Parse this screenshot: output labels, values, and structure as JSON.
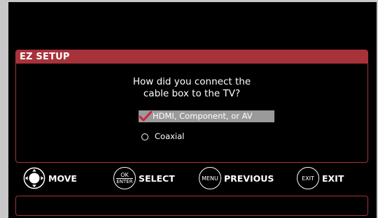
{
  "setup": {
    "title": "EZ SETUP",
    "question": "How did you connect the\ncable box to the TV?",
    "options": [
      {
        "label": "HDMI, Component, or AV",
        "selected": true
      },
      {
        "label": "Coaxial",
        "selected": false
      }
    ]
  },
  "nav": {
    "move": {
      "label": "MOVE",
      "icon": "dpad-icon"
    },
    "select": {
      "label": "SELECT",
      "icon_top": "OK",
      "icon_bottom": "ENTER"
    },
    "previous": {
      "label": "PREVIOUS",
      "icon_text": "MENU"
    },
    "exit": {
      "label": "EXIT",
      "icon_text": "EXIT"
    }
  },
  "colors": {
    "accent": "#a8323a",
    "selected_bg": "#9a9a9a",
    "check": "#d0243c"
  }
}
